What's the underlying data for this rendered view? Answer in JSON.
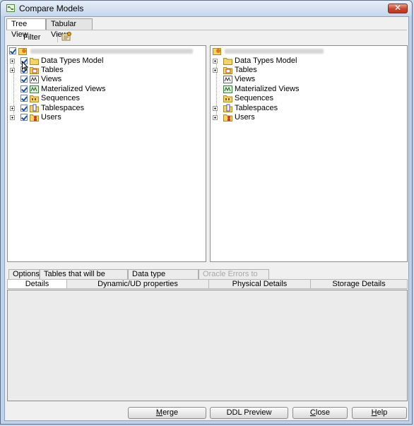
{
  "window": {
    "title": "Compare Models",
    "close_symbol": "✕"
  },
  "top_tabs": [
    {
      "label": "Tree View",
      "active": true
    },
    {
      "label": "Tabular View",
      "active": false
    }
  ],
  "toolbar": {
    "filter_label": "Filter",
    "filter_icon": "filter-settings-icon"
  },
  "left_tree": {
    "root_label_blurred": true,
    "items": [
      {
        "label": "Data Types Model",
        "icon": "folder-icon",
        "checked": true,
        "expandable": true
      },
      {
        "label": "Tables",
        "icon": "tables-icon",
        "checked": true,
        "expandable": true
      },
      {
        "label": "Views",
        "icon": "views-icon",
        "checked": true,
        "expandable": false
      },
      {
        "label": "Materialized Views",
        "icon": "materialized-views-icon",
        "checked": true,
        "expandable": false
      },
      {
        "label": "Sequences",
        "icon": "sequences-icon",
        "checked": true,
        "expandable": false
      },
      {
        "label": "Tablespaces",
        "icon": "tablespaces-icon",
        "checked": true,
        "expandable": true
      },
      {
        "label": "Users",
        "icon": "users-icon",
        "checked": true,
        "expandable": true
      }
    ]
  },
  "right_tree": {
    "root_label_blurred": true,
    "items": [
      {
        "label": "Data Types Model",
        "icon": "folder-icon",
        "expandable": true
      },
      {
        "label": "Tables",
        "icon": "tables-icon",
        "expandable": true
      },
      {
        "label": "Views",
        "icon": "views-icon",
        "expandable": false
      },
      {
        "label": "Materialized Views",
        "icon": "materialized-views-icon",
        "expandable": false
      },
      {
        "label": "Sequences",
        "icon": "sequences-icon",
        "expandable": false
      },
      {
        "label": "Tablespaces",
        "icon": "tablespaces-icon",
        "expandable": true
      },
      {
        "label": "Users",
        "icon": "users-icon",
        "expandable": true
      }
    ]
  },
  "option_tabs": [
    {
      "label": "Options",
      "disabled": false
    },
    {
      "label": "Tables that will be recreated",
      "disabled": false
    },
    {
      "label": "Data type conversion",
      "disabled": false
    },
    {
      "label": "Oracle Errors to Mask",
      "disabled": true
    }
  ],
  "detail_tabs": [
    {
      "label": "Details",
      "active": true
    },
    {
      "label": "Dynamic/UD properties",
      "active": false
    },
    {
      "label": "Physical Details",
      "active": false
    },
    {
      "label": "Storage Details",
      "active": false
    }
  ],
  "buttons": {
    "merge": {
      "before": "",
      "mnemonic": "M",
      "after": "erge"
    },
    "ddl_preview": {
      "label": "DDL Preview"
    },
    "close": {
      "before": "",
      "mnemonic": "C",
      "after": "lose"
    },
    "help": {
      "before": "",
      "mnemonic": "H",
      "after": "elp"
    }
  },
  "colors": {
    "window_frame": "#bfd2ea",
    "close_button": "#c7432c",
    "folder_yellow": "#f3d36b",
    "checkbox_border": "#6e87a8"
  }
}
